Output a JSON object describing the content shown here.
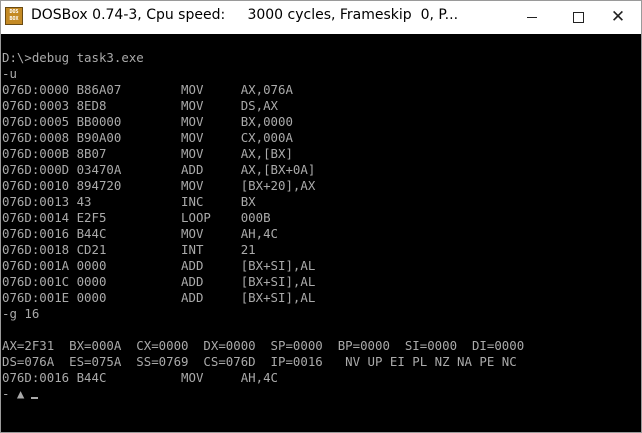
{
  "window": {
    "title": "DOSBox 0.74-3, Cpu speed:     3000 cycles, Frameskip  0, P...",
    "icon_top": "DOS",
    "icon_bottom": "BOX",
    "controls": {
      "minimize": "minimize-icon",
      "maximize": "maximize-icon",
      "close": "close-icon",
      "close_glyph": "✕"
    }
  },
  "console": {
    "lines": [
      "",
      "D:\\>debug task3.exe",
      "-u",
      "076D:0000 B86A07        MOV     AX,076A",
      "076D:0003 8ED8          MOV     DS,AX",
      "076D:0005 BB0000        MOV     BX,0000",
      "076D:0008 B90A00        MOV     CX,000A",
      "076D:000B 8B07          MOV     AX,[BX]",
      "076D:000D 03470A        ADD     AX,[BX+0A]",
      "076D:0010 894720        MOV     [BX+20],AX",
      "076D:0013 43            INC     BX",
      "076D:0014 E2F5          LOOP    000B",
      "076D:0016 B44C          MOV     AH,4C",
      "076D:0018 CD21          INT     21",
      "076D:001A 0000          ADD     [BX+SI],AL",
      "076D:001C 0000          ADD     [BX+SI],AL",
      "076D:001E 0000          ADD     [BX+SI],AL",
      "-g 16",
      "",
      "AX=2F31  BX=000A  CX=0000  DX=0000  SP=0000  BP=0000  SI=0000  DI=0000",
      "DS=076A  ES=075A  SS=0769  CS=076D  IP=0016   NV UP EI PL NZ NA PE NC",
      "076D:0016 B44C          MOV     AH,4C",
      "- ▲",
      "",
      "",
      ""
    ],
    "fg_color": "#aaaaaa",
    "bg_color": "#000000"
  }
}
